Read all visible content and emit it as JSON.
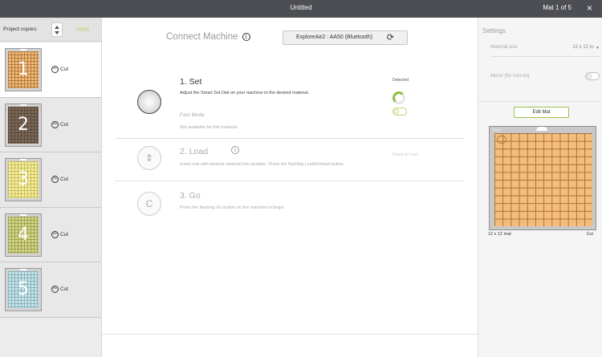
{
  "titlebar": {
    "title": "Untitled",
    "mat_count": "Mat 1 of 5",
    "close": "×"
  },
  "left": {
    "copies_label": "Project copies:",
    "apply_label": "Apply",
    "mats": [
      {
        "numeral": "1",
        "mode": "Cut",
        "color": "#f3bb7a",
        "line": "#b07a3e"
      },
      {
        "numeral": "2",
        "mode": "Cut",
        "color": "#7d6a5a",
        "line": "#5a4838"
      },
      {
        "numeral": "3",
        "mode": "Cut",
        "color": "#f6ee9e",
        "line": "#c7bd5e"
      },
      {
        "numeral": "4",
        "mode": "Cut",
        "color": "#d3d68a",
        "line": "#9fa24f"
      },
      {
        "numeral": "5",
        "mode": "Cut",
        "color": "#c7e3e8",
        "line": "#8ab3bd"
      }
    ]
  },
  "center": {
    "connect_title": "Connect Machine",
    "device_label": "ExploreAir2 : AA50 (Bluetooth)",
    "steps": {
      "set": {
        "title": "1. Set",
        "desc": "Adjust the Smart Set Dial on your machine to the desired material.",
        "fast_mode": "Fast Mode",
        "fast_desc": "Not available for this material.",
        "status": "Detected"
      },
      "load": {
        "title": "2. Load",
        "desc": "Insert mat with desired material into position. Press the flashing Load/Unload button.",
        "status": "Ready to load..."
      },
      "go": {
        "title": "3. Go",
        "desc": "Press the flashing Go button on the machine to begin."
      }
    }
  },
  "right": {
    "settings_title": "Settings",
    "material_size_label": "Material size",
    "material_size_value": "12 x 12 in.",
    "mirror_label": "Mirror (for iron-on)",
    "edit_mat_label": "Edit Mat",
    "preview_label": "Cricut",
    "mat_size_label": "12 x 12 mat",
    "mat_mode_label": "Cut"
  }
}
